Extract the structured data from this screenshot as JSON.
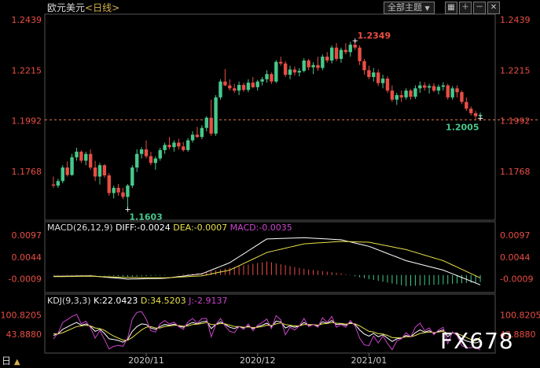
{
  "header": {
    "title": "欧元美元",
    "period": "<日线>",
    "theme_button": "全部主题",
    "theme_arrow": "▼",
    "icons": [
      "grid-icon",
      "plus-icon",
      "minus-icon",
      "close-icon"
    ]
  },
  "watermark": "FX678",
  "bottom_left": "日",
  "bottom_arrow": "▲",
  "colors": {
    "up": "#46c98c",
    "down": "#e84e44",
    "diff": "#ffffff",
    "dea": "#e8e04a",
    "macd": "#cc44cc",
    "j": "#cc44cc",
    "current_line": "#e87a4f"
  },
  "chart_data": [
    {
      "type": "candlestick",
      "y_ticks": [
        "1.2439",
        "1.2215",
        "1.1992",
        "1.1768"
      ],
      "ylim": [
        1.158,
        1.2449
      ],
      "x_ticks": [
        "2020/11",
        "2020/12",
        "2021/01"
      ],
      "current_value_line": 1.1996,
      "annotations": [
        {
          "label": "1.2349",
          "value": 1.2349,
          "index": 65
        },
        {
          "label": "1.1603",
          "value": 1.1603,
          "index": 16
        },
        {
          "label": "1.2005",
          "value": 1.2005,
          "index": 92
        }
      ],
      "ohlc": [
        [
          1.171,
          1.1745,
          1.1695,
          1.1705
        ],
        [
          1.1705,
          1.1735,
          1.1695,
          1.1725
        ],
        [
          1.1725,
          1.1795,
          1.1715,
          1.1785
        ],
        [
          1.1785,
          1.1812,
          1.1745,
          1.1752
        ],
        [
          1.1752,
          1.1845,
          1.1748,
          1.183
        ],
        [
          1.183,
          1.1872,
          1.1815,
          1.1855
        ],
        [
          1.1855,
          1.186,
          1.1805,
          1.1815
        ],
        [
          1.1815,
          1.1855,
          1.1795,
          1.1845
        ],
        [
          1.1845,
          1.1865,
          1.1775,
          1.1785
        ],
        [
          1.1785,
          1.1815,
          1.1725,
          1.1745
        ],
        [
          1.1745,
          1.1805,
          1.171,
          1.1795
        ],
        [
          1.1795,
          1.18,
          1.174,
          1.175
        ],
        [
          1.175,
          1.176,
          1.166,
          1.1672
        ],
        [
          1.1672,
          1.1705,
          1.1648,
          1.1695
        ],
        [
          1.1695,
          1.1712,
          1.166,
          1.1675
        ],
        [
          1.1675,
          1.1695,
          1.1645,
          1.1655
        ],
        [
          1.1655,
          1.1712,
          1.1603,
          1.1705
        ],
        [
          1.1705,
          1.1795,
          1.1695,
          1.1785
        ],
        [
          1.1785,
          1.1865,
          1.1765,
          1.1845
        ],
        [
          1.1845,
          1.1875,
          1.1825,
          1.1865
        ],
        [
          1.1865,
          1.1905,
          1.1825,
          1.1835
        ],
        [
          1.1835,
          1.1855,
          1.1795,
          1.1805
        ],
        [
          1.1805,
          1.1835,
          1.1775,
          1.1825
        ],
        [
          1.1825,
          1.1872,
          1.1815,
          1.1862
        ],
        [
          1.1862,
          1.1895,
          1.1845,
          1.1885
        ],
        [
          1.1885,
          1.192,
          1.1865,
          1.1875
        ],
        [
          1.1875,
          1.1905,
          1.1855,
          1.1895
        ],
        [
          1.1895,
          1.1912,
          1.1865,
          1.1878
        ],
        [
          1.1878,
          1.1898,
          1.1855,
          1.1862
        ],
        [
          1.1862,
          1.1915,
          1.1855,
          1.1905
        ],
        [
          1.1905,
          1.1945,
          1.1895,
          1.193
        ],
        [
          1.193,
          1.1965,
          1.1915,
          1.192
        ],
        [
          1.192,
          1.1972,
          1.191,
          1.196
        ],
        [
          1.196,
          1.2012,
          1.1945,
          1.2005
        ],
        [
          1.2005,
          1.2085,
          1.1925,
          1.1935
        ],
        [
          1.1935,
          1.2105,
          1.1925,
          1.2095
        ],
        [
          1.2095,
          1.2175,
          1.2085,
          1.2165
        ],
        [
          1.2165,
          1.222,
          1.2145,
          1.2148
        ],
        [
          1.2148,
          1.2175,
          1.2125,
          1.2135
        ],
        [
          1.2135,
          1.2155,
          1.2115,
          1.2125
        ],
        [
          1.2125,
          1.2165,
          1.2105,
          1.215
        ],
        [
          1.215,
          1.216,
          1.212,
          1.2128
        ],
        [
          1.2128,
          1.2175,
          1.2118,
          1.216
        ],
        [
          1.216,
          1.2185,
          1.2135,
          1.214
        ],
        [
          1.214,
          1.2172,
          1.2125,
          1.2165
        ],
        [
          1.2165,
          1.2185,
          1.2148,
          1.2175
        ],
        [
          1.2175,
          1.2215,
          1.216,
          1.2198
        ],
        [
          1.2198,
          1.2205,
          1.2155,
          1.2165
        ],
        [
          1.2165,
          1.226,
          1.2158,
          1.2252
        ],
        [
          1.2252,
          1.2275,
          1.2235,
          1.2245
        ],
        [
          1.2245,
          1.2255,
          1.2185,
          1.2195
        ],
        [
          1.2195,
          1.2235,
          1.2175,
          1.2218
        ],
        [
          1.2218,
          1.2232,
          1.2192,
          1.2205
        ],
        [
          1.2205,
          1.2225,
          1.2188,
          1.2212
        ],
        [
          1.2212,
          1.2268,
          1.2205,
          1.2258
        ],
        [
          1.2258,
          1.2265,
          1.2215,
          1.2228
        ],
        [
          1.2228,
          1.225,
          1.2198,
          1.2238
        ],
        [
          1.2238,
          1.2275,
          1.2212,
          1.2225
        ],
        [
          1.2225,
          1.2285,
          1.2215,
          1.2275
        ],
        [
          1.2275,
          1.2295,
          1.2248,
          1.2258
        ],
        [
          1.2258,
          1.2325,
          1.2245,
          1.2315
        ],
        [
          1.2315,
          1.2335,
          1.2255,
          1.2265
        ],
        [
          1.2265,
          1.2315,
          1.2248,
          1.2305
        ],
        [
          1.2305,
          1.2335,
          1.2285,
          1.2295
        ],
        [
          1.2295,
          1.234,
          1.2275,
          1.2328
        ],
        [
          1.2328,
          1.2349,
          1.2305,
          1.2315
        ],
        [
          1.2315,
          1.2325,
          1.2238,
          1.2255
        ],
        [
          1.2255,
          1.2265,
          1.2195,
          1.2215
        ],
        [
          1.2215,
          1.2235,
          1.2175,
          1.2185
        ],
        [
          1.2185,
          1.2225,
          1.2165,
          1.2205
        ],
        [
          1.2205,
          1.2218,
          1.2145,
          1.2158
        ],
        [
          1.2158,
          1.2195,
          1.2135,
          1.2178
        ],
        [
          1.2178,
          1.2188,
          1.2115,
          1.2125
        ],
        [
          1.2125,
          1.2148,
          1.2075,
          1.2085
        ],
        [
          1.2085,
          1.2115,
          1.2062,
          1.2105
        ],
        [
          1.2105,
          1.2125,
          1.2075,
          1.2095
        ],
        [
          1.2095,
          1.2135,
          1.2085,
          1.2125
        ],
        [
          1.2125,
          1.2132,
          1.2085,
          1.2098
        ],
        [
          1.2098,
          1.2148,
          1.2088,
          1.2135
        ],
        [
          1.2135,
          1.2165,
          1.2115,
          1.2148
        ],
        [
          1.2148,
          1.2162,
          1.2125,
          1.2138
        ],
        [
          1.2138,
          1.2155,
          1.2112,
          1.2145
        ],
        [
          1.2145,
          1.2158,
          1.2118,
          1.2125
        ],
        [
          1.2125,
          1.2152,
          1.2108,
          1.2142
        ],
        [
          1.2142,
          1.2162,
          1.2125,
          1.2148
        ],
        [
          1.2148,
          1.2155,
          1.2085,
          1.2095
        ],
        [
          1.2095,
          1.2145,
          1.2085,
          1.2135
        ],
        [
          1.2135,
          1.2148,
          1.2095,
          1.2118
        ],
        [
          1.2118,
          1.2125,
          1.2065,
          1.2075
        ],
        [
          1.2075,
          1.2095,
          1.2035,
          1.2045
        ],
        [
          1.2045,
          1.2055,
          1.2015,
          1.2025
        ],
        [
          1.2025,
          1.2035,
          1.1998,
          1.2012
        ],
        [
          1.2012,
          1.2028,
          1.2005,
          1.2018
        ]
      ]
    },
    {
      "type": "macd",
      "label": "MACD(26,12,9)",
      "values_text": {
        "diff": "DIFF:-0.0024",
        "dea": "DEA:-0.0007",
        "macd": "MACD:-0.0035"
      },
      "y_ticks": [
        "0.0097",
        "0.0044",
        "-0.0009"
      ],
      "ylim": [
        -0.0035,
        0.0105
      ],
      "series": [
        {
          "name": "DIFF",
          "key": "diff",
          "anchors": [
            [
              0,
              -0.0003
            ],
            [
              8,
              -0.0002
            ],
            [
              16,
              -0.001
            ],
            [
              24,
              -0.0008
            ],
            [
              32,
              0.0003
            ],
            [
              38,
              0.003
            ],
            [
              46,
              0.0088
            ],
            [
              54,
              0.0091
            ],
            [
              62,
              0.0086
            ],
            [
              68,
              0.007
            ],
            [
              76,
              0.0035
            ],
            [
              84,
              0.0012
            ],
            [
              92,
              -0.0024
            ]
          ]
        },
        {
          "name": "DEA",
          "key": "dea",
          "anchors": [
            [
              0,
              -0.0004
            ],
            [
              8,
              -0.0003
            ],
            [
              16,
              -0.0006
            ],
            [
              24,
              -0.0007
            ],
            [
              32,
              -0.0002
            ],
            [
              38,
              0.0012
            ],
            [
              46,
              0.0055
            ],
            [
              54,
              0.0076
            ],
            [
              62,
              0.0082
            ],
            [
              68,
              0.008
            ],
            [
              76,
              0.0062
            ],
            [
              84,
              0.0035
            ],
            [
              92,
              -0.0007
            ]
          ]
        }
      ]
    },
    {
      "type": "kdj",
      "label": "KDJ(9,3,3)",
      "values_text": {
        "k": "K:22.0423",
        "d": "D:34.5203",
        "j": "J:-2.9137"
      },
      "y_ticks": [
        "100.8205",
        "43.8880"
      ],
      "ylim": [
        -5,
        120
      ],
      "series": [
        {
          "name": "K",
          "key": "k",
          "values": [
            40,
            45,
            58,
            65,
            72,
            78,
            70,
            74,
            66,
            52,
            58,
            46,
            30,
            28,
            25,
            20,
            28,
            52,
            66,
            74,
            72,
            62,
            58,
            66,
            72,
            70,
            73,
            68,
            64,
            72,
            78,
            74,
            80,
            82,
            60,
            72,
            80,
            72,
            64,
            60,
            66,
            62,
            68,
            60,
            66,
            70,
            76,
            66,
            82,
            80,
            62,
            68,
            64,
            68,
            78,
            70,
            72,
            68,
            80,
            76,
            84,
            72,
            74,
            70,
            78,
            72,
            56,
            44,
            38,
            46,
            36,
            42,
            32,
            22,
            30,
            32,
            40,
            36,
            48,
            56,
            50,
            54,
            46,
            52,
            56,
            36,
            48,
            44,
            30,
            24,
            20,
            18,
            22
          ]
        },
        {
          "name": "D",
          "key": "d",
          "values": [
            45,
            44,
            48,
            54,
            60,
            66,
            68,
            70,
            68,
            62,
            60,
            55,
            46,
            38,
            32,
            26,
            26,
            34,
            45,
            56,
            64,
            66,
            62,
            62,
            66,
            68,
            70,
            69,
            67,
            68,
            72,
            73,
            75,
            78,
            72,
            72,
            75,
            74,
            70,
            66,
            66,
            64,
            65,
            63,
            64,
            66,
            70,
            69,
            74,
            77,
            72,
            70,
            68,
            68,
            72,
            72,
            72,
            70,
            74,
            75,
            78,
            76,
            75,
            73,
            75,
            74,
            68,
            60,
            52,
            50,
            45,
            44,
            40,
            34,
            33,
            33,
            36,
            36,
            40,
            46,
            48,
            50,
            48,
            50,
            52,
            46,
            47,
            46,
            40,
            34,
            28,
            24,
            34.52
          ]
        },
        {
          "name": "J",
          "key": "j",
          "values": [
            30,
            47,
            78,
            87,
            96,
            102,
            74,
            82,
            62,
            32,
            54,
            28,
            0,
            8,
            11,
            8,
            32,
            88,
            108,
            110,
            88,
            54,
            50,
            74,
            84,
            74,
            79,
            66,
            58,
            80,
            90,
            76,
            90,
            90,
            36,
            72,
            90,
            68,
            52,
            48,
            66,
            58,
            74,
            54,
            70,
            78,
            88,
            60,
            98,
            86,
            42,
            64,
            56,
            68,
            90,
            66,
            72,
            64,
            92,
            78,
            96,
            64,
            72,
            64,
            84,
            68,
            32,
            12,
            10,
            38,
            18,
            38,
            16,
            -2,
            24,
            30,
            48,
            36,
            64,
            76,
            54,
            62,
            42,
            56,
            64,
            16,
            50,
            40,
            10,
            4,
            4,
            6,
            -2.91
          ]
        }
      ]
    }
  ]
}
